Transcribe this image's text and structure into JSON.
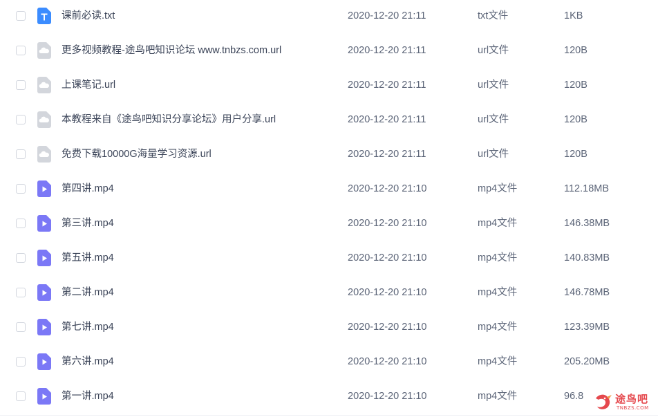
{
  "colors": {
    "text_primary": "#3b4458",
    "text_secondary": "#5c6578",
    "txt_icon": "#3b8cff",
    "url_icon": "#d3d6dc",
    "video_icon": "#7b78f6",
    "watermark": "#e5484d"
  },
  "files": [
    {
      "name": "课前必读.txt",
      "date": "2020-12-20 21:11",
      "type": "txt文件",
      "size": "1KB",
      "icon": "txt-file-icon"
    },
    {
      "name": "更多视频教程-途鸟吧知识论坛 www.tnbzs.com.url",
      "date": "2020-12-20 21:11",
      "type": "url文件",
      "size": "120B",
      "icon": "url-file-icon"
    },
    {
      "name": "上课笔记.url",
      "date": "2020-12-20 21:11",
      "type": "url文件",
      "size": "120B",
      "icon": "url-file-icon"
    },
    {
      "name": "本教程来自《途鸟吧知识分享论坛》用户分享.url",
      "date": "2020-12-20 21:11",
      "type": "url文件",
      "size": "120B",
      "icon": "url-file-icon"
    },
    {
      "name": "免费下载10000G海量学习资源.url",
      "date": "2020-12-20 21:11",
      "type": "url文件",
      "size": "120B",
      "icon": "url-file-icon"
    },
    {
      "name": "第四讲.mp4",
      "date": "2020-12-20 21:10",
      "type": "mp4文件",
      "size": "112.18MB",
      "icon": "video-file-icon"
    },
    {
      "name": "第三讲.mp4",
      "date": "2020-12-20 21:10",
      "type": "mp4文件",
      "size": "146.38MB",
      "icon": "video-file-icon"
    },
    {
      "name": "第五讲.mp4",
      "date": "2020-12-20 21:10",
      "type": "mp4文件",
      "size": "140.83MB",
      "icon": "video-file-icon"
    },
    {
      "name": "第二讲.mp4",
      "date": "2020-12-20 21:10",
      "type": "mp4文件",
      "size": "146.78MB",
      "icon": "video-file-icon"
    },
    {
      "name": "第七讲.mp4",
      "date": "2020-12-20 21:10",
      "type": "mp4文件",
      "size": "123.39MB",
      "icon": "video-file-icon"
    },
    {
      "name": "第六讲.mp4",
      "date": "2020-12-20 21:10",
      "type": "mp4文件",
      "size": "205.20MB",
      "icon": "video-file-icon"
    },
    {
      "name": "第一讲.mp4",
      "date": "2020-12-20 21:10",
      "type": "mp4文件",
      "size": "96.8",
      "icon": "video-file-icon"
    }
  ],
  "watermark": {
    "text": "途鸟吧",
    "sub": "TNBZS.COM"
  }
}
